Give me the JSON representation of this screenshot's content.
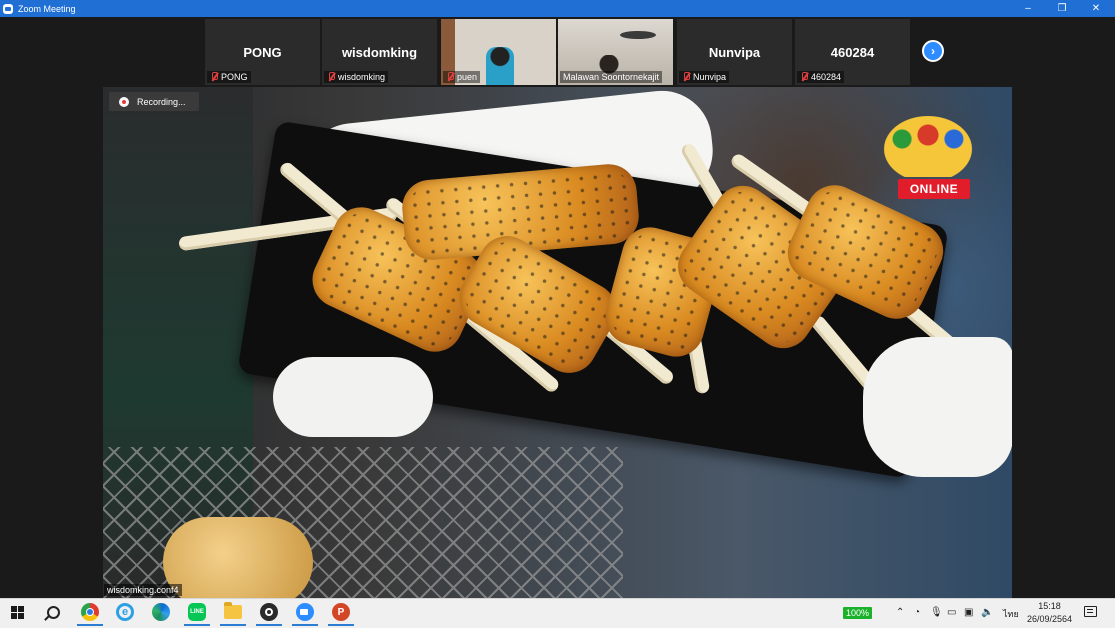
{
  "window": {
    "title": "Zoom Meeting",
    "controls": [
      "–",
      "❐",
      "✕"
    ]
  },
  "participants": [
    {
      "display": "PONG",
      "label": "PONG",
      "muted": true,
      "video": false
    },
    {
      "display": "wisdomking",
      "label": "wisdomking",
      "muted": true,
      "video": false
    },
    {
      "display": "",
      "label": "puen",
      "muted": true,
      "video": true
    },
    {
      "display": "",
      "label": "Malawan Soontornekajit",
      "muted": false,
      "video": true
    },
    {
      "display": "Nunvipa",
      "label": "Nunvipa",
      "muted": true,
      "video": false
    },
    {
      "display": "460284",
      "label": "460284",
      "muted": true,
      "video": false
    }
  ],
  "next_button": "›",
  "recording": {
    "label": "Recording..."
  },
  "main_video": {
    "speaker_label": "wisdomking.conf4",
    "overlay_logo_text": "ONLINE"
  },
  "taskbar": {
    "battery": "100%",
    "language": "ไทย",
    "time": "15:18",
    "date": "26/09/2564",
    "apps": [
      "windows-start",
      "search",
      "chrome",
      "internet-explorer",
      "edge",
      "line",
      "file-explorer",
      "obs",
      "zoom",
      "powerpoint"
    ]
  },
  "colors": {
    "titlebar": "#1f6fd4",
    "zoom_blue": "#2d8cff",
    "muted_red": "#e04040",
    "battery_green": "#1bb12b"
  }
}
